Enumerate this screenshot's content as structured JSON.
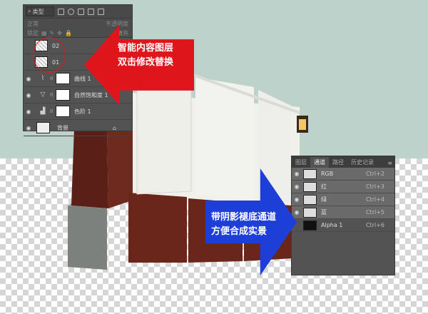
{
  "layers_panel": {
    "filter_label": "类型",
    "blend_mode": "正常",
    "opacity_label": "不透明度",
    "lock_label": "锁定",
    "fill_label": "填充",
    "layers": [
      {
        "name": "02",
        "kind": "smart-object"
      },
      {
        "name": "01",
        "kind": "smart-object"
      },
      {
        "name": "曲线 1",
        "kind": "curves-adjustment"
      },
      {
        "name": "自然饱和度 1",
        "kind": "vibrance-adjustment"
      },
      {
        "name": "色阶 1",
        "kind": "levels-adjustment"
      },
      {
        "name": "背景",
        "kind": "background",
        "locked": true
      }
    ]
  },
  "channels_panel": {
    "tabs": [
      "图层",
      "通道",
      "路径",
      "历史记录"
    ],
    "active_tab": "通道",
    "channels": [
      {
        "name": "RGB",
        "shortcut": "Ctrl+2"
      },
      {
        "name": "红",
        "shortcut": "Ctrl+3"
      },
      {
        "name": "绿",
        "shortcut": "Ctrl+4"
      },
      {
        "name": "蓝",
        "shortcut": "Ctrl+5"
      },
      {
        "name": "Alpha 1",
        "shortcut": "Ctrl+6"
      }
    ]
  },
  "callouts": {
    "red_line1": "智能内容图层",
    "red_line2": "双击修改替换",
    "blue_line1": "带阴影褪底通道",
    "blue_line2": "方便合成实景"
  },
  "colors": {
    "red_arrow": "#df151c",
    "blue_arrow": "#1d3fd8",
    "panel_bg": "#535353",
    "sky": "#bdd2cb"
  }
}
